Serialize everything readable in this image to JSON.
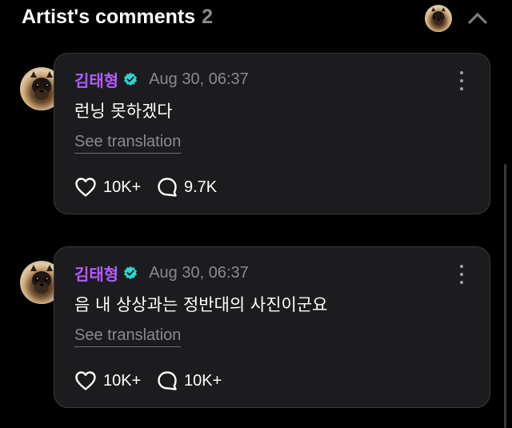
{
  "header": {
    "title": "Artist's comments",
    "count": "2"
  },
  "comments": [
    {
      "author": "김태형",
      "timestamp": "Aug 30, 06:37",
      "text": "런닝 못하겠다",
      "see_translation": "See translation",
      "likes": "10K+",
      "replies": "9.7K"
    },
    {
      "author": "김태형",
      "timestamp": "Aug 30, 06:37",
      "text": "음 내 상상과는 정반대의 사진이군요",
      "see_translation": "See translation",
      "likes": "10K+",
      "replies": "10K+"
    }
  ],
  "colors": {
    "background": "#000000",
    "card": "#1c1c1e",
    "card_border": "#3a3a3c",
    "author": "#b35cff",
    "verified": "#2fd4d0",
    "muted": "#8a8a8e"
  },
  "icons": [
    "avatar",
    "chevron-up-icon",
    "verified-badge-icon",
    "more-options-icon",
    "heart-icon",
    "comment-bubble-icon"
  ]
}
